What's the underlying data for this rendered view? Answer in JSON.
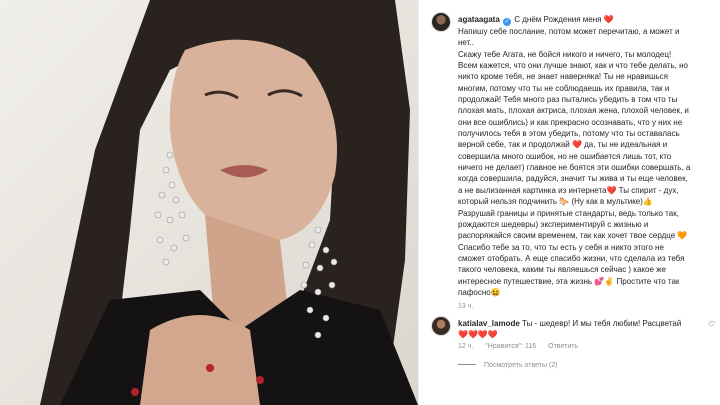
{
  "post": {
    "author": "agataagata",
    "verified_icon": "verified-badge-icon",
    "caption_lines": [
      "С днём Рождения меня ❤️",
      "Напишу себе послание, потом может перечитаю, а может и",
      "нет..",
      "Скажу тебе Агата, не бойся никого и ничего, ты молодец!",
      "Всем кажется, что они лучше знают, как и что тебе делать, но",
      "никто кроме тебя, не знает наверняка! Ты не нравишься",
      "многим, потому что ты не соблюдаешь их правила, так и",
      "продолжай! Тебя много раз пытались убедить в том что ты",
      "плохая мать, плохая актриса, плохая жена, плохой человек, и",
      "они все ошиблись) и как прекрасно осознавать, что у них не",
      "получилось тебя в этом убедить, потому что ты оставалась",
      "верной себе, так и продолжай ❤️ да, ты не идеальная и",
      "совершила много ошибок, но не ошибается лишь тот, кто",
      "ничего не делает) главное не боятся эти ошибки совершать, а",
      "когда совершила, радуйся, значит ты жива и ты еще человек,",
      "а не вылизанная картинка из интернета❤️ Ты спирит - дух,",
      "который нельзя подчинить 🐎 (Ну как в мультике)👍",
      "Разрушай границы и принятые стандарты, ведь только так,",
      "рождаются шедевры) экспериментируй с жизнью и",
      "распоряжайся своим временем, так как хочет твое сердце 🧡",
      "Спасибо тебе за то, что ты есть у себя и никто этого не",
      "сможет отобрать. А еще спасибо жизни, что сделала из тебя",
      "такого человека, каким ты являешься сейчас ) какое же",
      "интересное путешествие, эта жизнь 💕✌️ Простите что так",
      "пафосно😆"
    ],
    "time": "13 ч."
  },
  "comment": {
    "author": "katialav_lamode",
    "text": "Ты - шедевр! И мы тебя любим! Расцветай",
    "hearts": "❤️❤️❤️❤️",
    "time": "12 ч.",
    "likes": "\"Нравится\": 116",
    "reply": "Ответить",
    "view_replies": "Посмотреть ответы (2)",
    "like_icon": "heart-outline-icon"
  },
  "colors": {
    "link_blue": "#3897f0",
    "heart_red": "#ed1c24",
    "muted": "#8e8e8e"
  }
}
